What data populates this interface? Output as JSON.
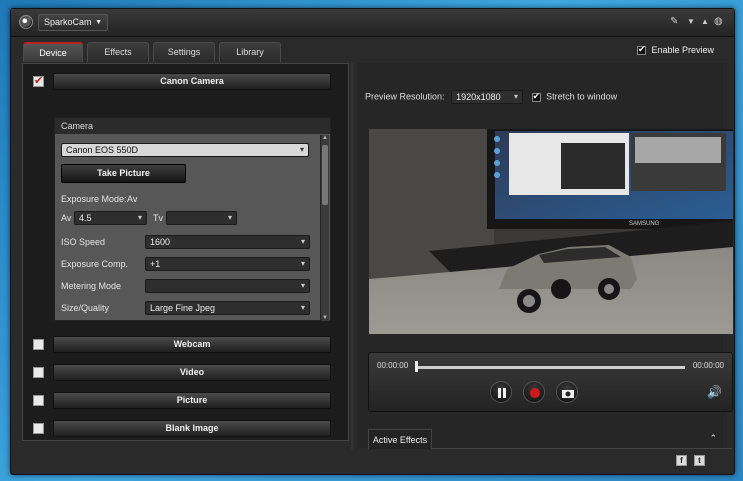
{
  "app": {
    "name": "SparkoCam"
  },
  "tabs": [
    {
      "label": "Device",
      "active": true
    },
    {
      "label": "Effects",
      "active": false
    },
    {
      "label": "Settings",
      "active": false
    },
    {
      "label": "Library",
      "active": false
    }
  ],
  "enable_preview": {
    "label": "Enable Preview",
    "checked": true
  },
  "sources": {
    "canon": {
      "label": "Canon Camera",
      "checked": true
    },
    "webcam": {
      "label": "Webcam",
      "checked": false
    },
    "video": {
      "label": "Video",
      "checked": false
    },
    "picture": {
      "label": "Picture",
      "checked": false
    },
    "blank": {
      "label": "Blank Image",
      "checked": false
    }
  },
  "camera": {
    "section_title": "Camera",
    "model": "Canon EOS 550D",
    "take_picture": "Take Picture",
    "exposure_mode_label": "Exposure Mode:",
    "exposure_mode_value": "Av",
    "av_label": "Av",
    "av_value": "4.5",
    "tv_label": "Tv",
    "tv_value": "",
    "iso_label": "ISO Speed",
    "iso_value": "1600",
    "exposure_comp_label": "Exposure Comp.",
    "exposure_comp_value": "+1",
    "metering_label": "Metering Mode",
    "metering_value": "",
    "size_quality_label": "Size/Quality",
    "size_quality_value": "Large Fine Jpeg"
  },
  "preview": {
    "resolution_label": "Preview Resolution:",
    "resolution_value": "1920x1080",
    "stretch_label": "Stretch to window",
    "stretch_checked": true
  },
  "player": {
    "time_current": "00:00:00",
    "time_total": "00:00:00"
  },
  "effects_panel": {
    "label": "Active Effects"
  },
  "monitor": {
    "brand": "SAMSUNG"
  },
  "colors": {
    "accent_red": "#c41e1e",
    "panel_bg": "#2a2a2a"
  }
}
